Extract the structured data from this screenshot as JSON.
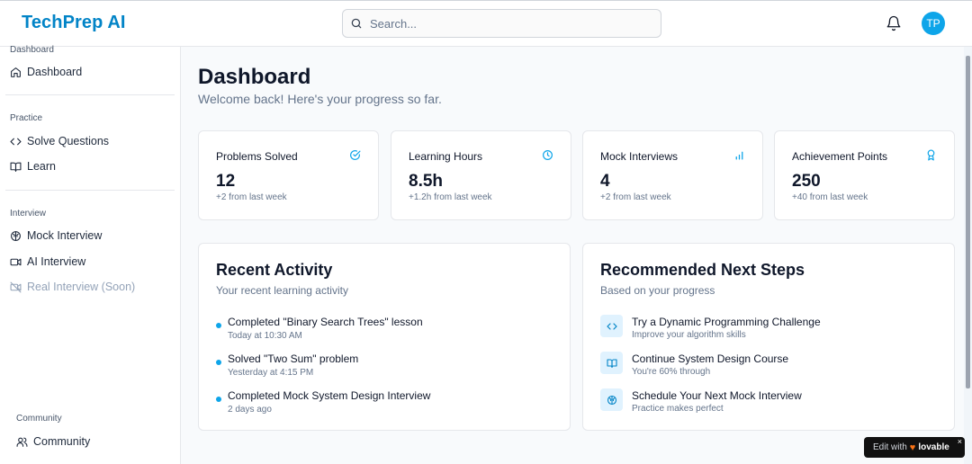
{
  "header": {
    "logo": "TechPrep AI",
    "search_placeholder": "Search...",
    "avatar_initials": "TP"
  },
  "sidebar": {
    "sections": [
      {
        "label": "Dashboard",
        "items": [
          {
            "label": "Dashboard",
            "icon": "home-icon"
          }
        ]
      },
      {
        "label": "Practice",
        "items": [
          {
            "label": "Solve Questions",
            "icon": "code-icon"
          },
          {
            "label": "Learn",
            "icon": "book-icon"
          }
        ]
      },
      {
        "label": "Interview",
        "items": [
          {
            "label": "Mock Interview",
            "icon": "brain-icon"
          },
          {
            "label": "AI Interview",
            "icon": "video-icon"
          },
          {
            "label": "Real Interview (Soon)",
            "icon": "video-off-icon",
            "disabled": true
          }
        ]
      },
      {
        "label": "Community",
        "items": [
          {
            "label": "Community",
            "icon": "users-icon"
          }
        ]
      }
    ]
  },
  "main": {
    "title": "Dashboard",
    "subtitle": "Welcome back! Here's your progress so far.",
    "stats": [
      {
        "label": "Problems Solved",
        "value": "12",
        "delta": "+2 from last week",
        "icon": "check-circle-icon"
      },
      {
        "label": "Learning Hours",
        "value": "8.5h",
        "delta": "+1.2h from last week",
        "icon": "clock-icon"
      },
      {
        "label": "Mock Interviews",
        "value": "4",
        "delta": "+2 from last week",
        "icon": "bar-chart-icon"
      },
      {
        "label": "Achievement Points",
        "value": "250",
        "delta": "+40 from last week",
        "icon": "award-icon"
      }
    ],
    "recent_activity": {
      "title": "Recent Activity",
      "subtitle": "Your recent learning activity",
      "items": [
        {
          "title": "Completed \"Binary Search Trees\" lesson",
          "time": "Today at 10:30 AM"
        },
        {
          "title": "Solved \"Two Sum\" problem",
          "time": "Yesterday at 4:15 PM"
        },
        {
          "title": "Completed Mock System Design Interview",
          "time": "2 days ago"
        }
      ]
    },
    "next_steps": {
      "title": "Recommended Next Steps",
      "subtitle": "Based on your progress",
      "items": [
        {
          "title": "Try a Dynamic Programming Challenge",
          "desc": "Improve your algorithm skills",
          "icon": "code-icon"
        },
        {
          "title": "Continue System Design Course",
          "desc": "You're 60% through",
          "icon": "book-icon"
        },
        {
          "title": "Schedule Your Next Mock Interview",
          "desc": "Practice makes perfect",
          "icon": "brain-icon"
        }
      ]
    }
  },
  "badge": {
    "edit": "Edit with",
    "brand": "lovable",
    "close": "×"
  },
  "colors": {
    "accent": "#0ea5e9",
    "logo": "#0284c7"
  }
}
